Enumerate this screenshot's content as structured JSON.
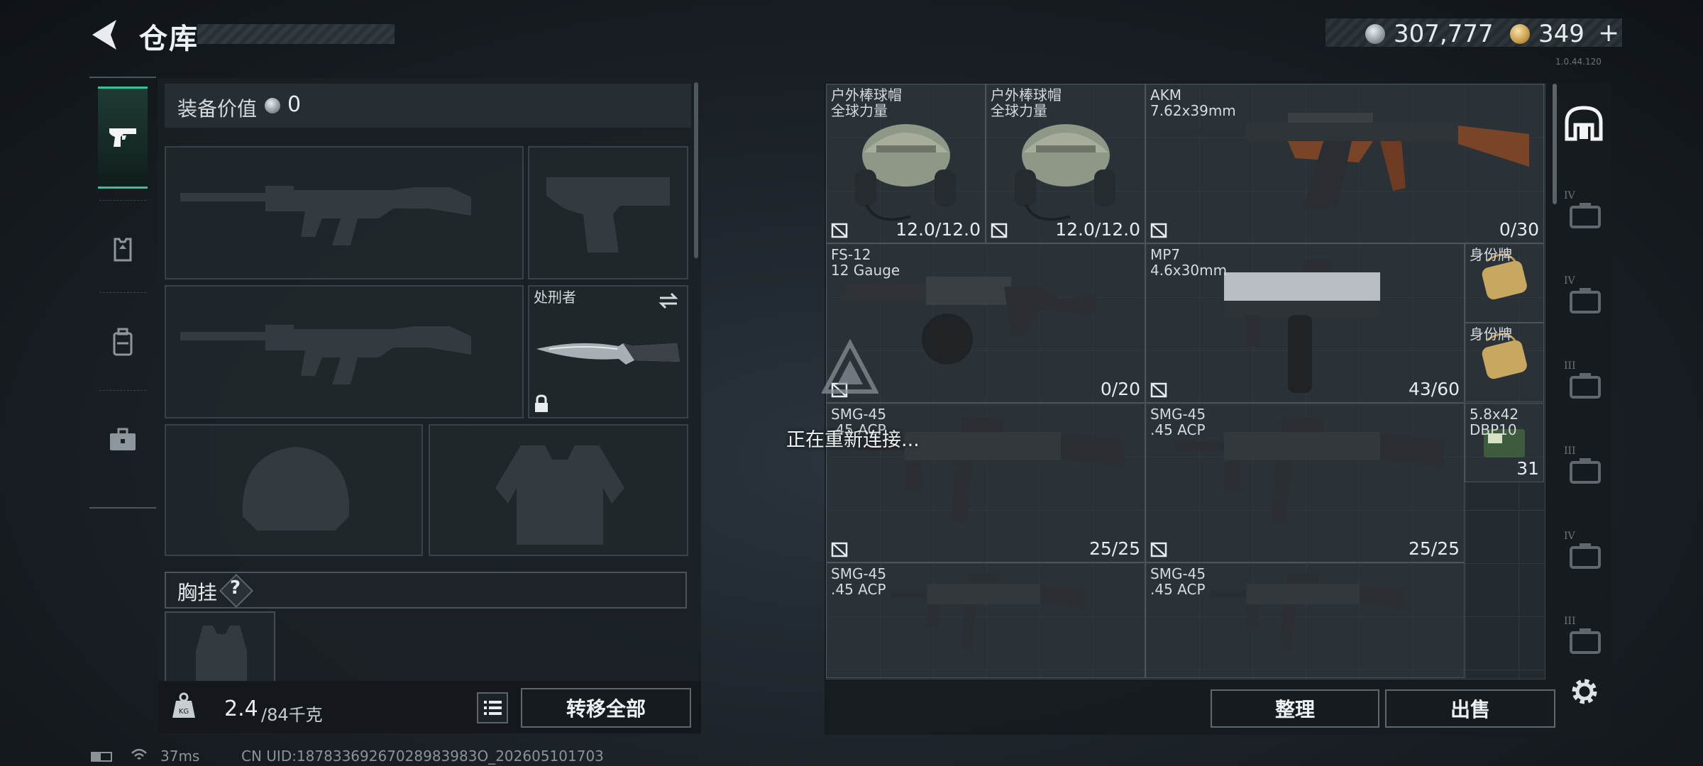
{
  "header": {
    "title": "仓库",
    "version": "1.0.44.120",
    "currency": {
      "silver": "307,777",
      "gold": "349",
      "gold_plus": "+"
    }
  },
  "nav": {
    "items": [
      {
        "name": "weapons",
        "icon": "pistol-icon",
        "active": true
      },
      {
        "name": "armor",
        "icon": "armor-icon"
      },
      {
        "name": "backpack",
        "icon": "backpack-icon"
      },
      {
        "name": "case",
        "icon": "briefcase-icon"
      }
    ]
  },
  "loadout": {
    "equip_value_label": "装备价值",
    "equip_value": "0",
    "melee_name": "处刑者",
    "chest_rig_label": "胸挂",
    "chest_rig_help": "?",
    "weight_current": "2.4",
    "weight_max": "/84千克",
    "move_all_label": "转移全部"
  },
  "storage": {
    "items": [
      {
        "name": "户外棒球帽\n全球力量",
        "count": "12.0/12.0",
        "kind": "headset"
      },
      {
        "name": "户外棒球帽\n全球力量",
        "count": "12.0/12.0",
        "kind": "headset"
      },
      {
        "name": "AKM\n7.62x39mm",
        "count": "0/30",
        "kind": "rifle"
      },
      {
        "name": "FS-12\n12 Gauge",
        "count": "0/20",
        "kind": "shotgun"
      },
      {
        "name": "MP7\n4.6x30mm",
        "count": "43/60",
        "kind": "smg"
      },
      {
        "name": "身份牌",
        "count": "",
        "kind": "tag"
      },
      {
        "name": "身份牌",
        "count": "",
        "kind": "tag"
      },
      {
        "name": "SMG-45\n.45 ACP",
        "count": "25/25",
        "kind": "smg45"
      },
      {
        "name": "SMG-45\n.45 ACP",
        "count": "25/25",
        "kind": "smg45"
      },
      {
        "name": "5.8x42\nDBP10",
        "count": "31",
        "kind": "ammo"
      },
      {
        "name": "SMG-45\n.45 ACP",
        "count": "",
        "kind": "smg45"
      },
      {
        "name": "SMG-45\n.45 ACP",
        "count": "",
        "kind": "smg45"
      }
    ],
    "sort_label": "整理",
    "sell_label": "出售"
  },
  "side_nav": [
    "IV",
    "IV",
    "III",
    "III",
    "IV",
    "III"
  ],
  "overlay": {
    "reconnect_text": "正在重新连接..."
  },
  "status": {
    "ping": "37ms",
    "uid": "CN UID:18783369267028983983O_202605101703"
  },
  "colors": {
    "accent": "#2fc59b",
    "panel": "#1a2025",
    "border": "#39424a"
  }
}
